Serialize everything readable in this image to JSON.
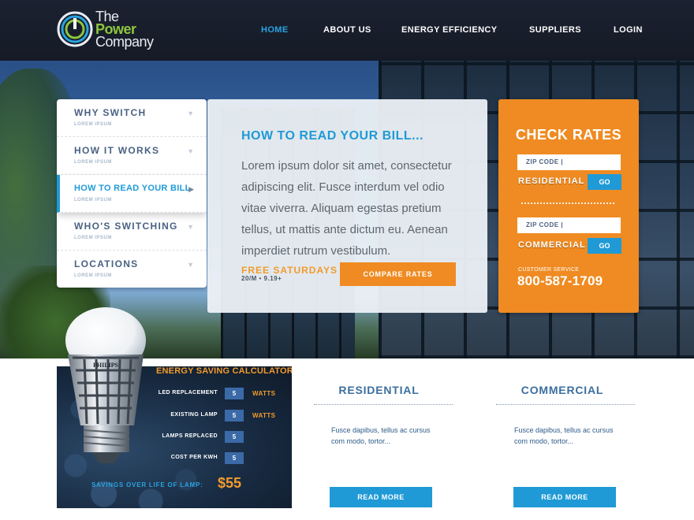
{
  "brand": {
    "line1": "The",
    "line2": "Power",
    "line3": "Company",
    "accent_color": "#8ec63f"
  },
  "nav": {
    "items": [
      {
        "label": "HOME",
        "active": true
      },
      {
        "label": "ABOUT US",
        "active": false
      },
      {
        "label": "ENERGY EFFICIENCY",
        "active": false
      },
      {
        "label": "SUPPLIERS",
        "active": false
      },
      {
        "label": "LOGIN",
        "active": false
      }
    ],
    "active_color": "#2aa3e0"
  },
  "sidemenu": {
    "items": [
      {
        "title": "WHY SWITCH",
        "sub": "LOREM IPSUM",
        "active": false
      },
      {
        "title": "HOW IT WORKS",
        "sub": "LOREM IPSUM",
        "active": false
      },
      {
        "title": "HOW TO READ YOUR BILL",
        "sub": "LOREM IPSUM",
        "active": true
      },
      {
        "title": "WHO'S SWITCHING",
        "sub": "LOREM IPSUM",
        "active": false
      },
      {
        "title": "LOCATIONS",
        "sub": "LOREM IPSUM",
        "active": false
      }
    ]
  },
  "info": {
    "title": "HOW TO READ YOUR BILL...",
    "body": "Lorem ipsum dolor sit amet, consectetur adipiscing elit. Fusce interdum vel odio vitae viverra. Aliquam egestas pretium tellus, ut mattis ante dictum eu. Aenean imperdiet rutrum vestibulum.",
    "promo_title": "FREE SATURDAYS",
    "promo_sub": "20/M • 9.19+",
    "compare_label": "COMPARE RATES"
  },
  "rates": {
    "title": "CHECK RATES",
    "residential": {
      "zip_text": "ZIP CODE |",
      "label": "RESIDENTIAL",
      "go": "GO"
    },
    "commercial": {
      "zip_text": "ZIP CODE |",
      "label": "COMMERCIAL",
      "go": "GO"
    },
    "customer_service_label": "CUSTOMER SERVICE",
    "phone": "800-587-1709",
    "panel_color": "#ef8b22"
  },
  "calculator": {
    "title": "ENERGY SAVING CALCULATOR",
    "rows": [
      {
        "label": "LED REPLACEMENT",
        "value": "5",
        "unit": "WATTS"
      },
      {
        "label": "EXISTING LAMP",
        "value": "5",
        "unit": "WATTS"
      },
      {
        "label": "LAMPS REPLACED",
        "value": "5",
        "unit": ""
      },
      {
        "label": "COST PER KWH",
        "value": "5",
        "unit": ""
      }
    ],
    "savings_label": "SAVINGS OVER LIFE OF LAMP:",
    "savings_value": "$55",
    "bulb_brand": "PHILIPS"
  },
  "cards": [
    {
      "title": "RESIDENTIAL",
      "text": "Fusce dapibus, tellus ac cursus com modo, tortor...",
      "button": "READ MORE"
    },
    {
      "title": "COMMERCIAL",
      "text": "Fusce dapibus, tellus ac cursus com modo, tortor...",
      "button": "READ MORE"
    }
  ]
}
